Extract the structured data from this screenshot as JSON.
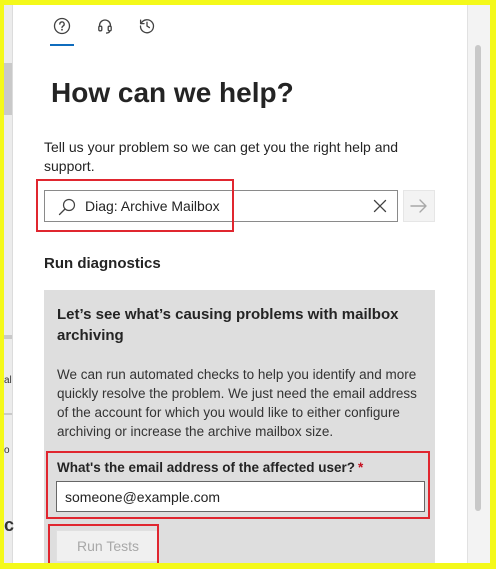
{
  "tabs": [
    {
      "name": "help",
      "icon": "question-circle-icon",
      "active": true
    },
    {
      "name": "support",
      "icon": "headset-icon",
      "active": false
    },
    {
      "name": "history",
      "icon": "history-icon",
      "active": false
    }
  ],
  "title": "How can we help?",
  "intro": "Tell us your problem so we can get you the right help and support.",
  "search": {
    "value": "Diag: Archive Mailbox",
    "icon": "search-icon",
    "clear_icon": "close-icon",
    "submit_icon": "arrow-right-icon"
  },
  "section_title": "Run diagnostics",
  "diagnostic": {
    "title": "Let’s see what’s causing problems with mailbox archiving",
    "description": "We can run automated checks to help you identify and more quickly resolve the problem. We just need the email address of the account for which you would like to either configure archiving or increase the archive mailbox size.",
    "email_label": "What's the email address of the affected user?",
    "required_marker": "*",
    "email_value": "someone@example.com",
    "run_button": "Run Tests"
  },
  "left_edge": {
    "glyph_1": "al",
    "glyph_2": "o",
    "glyph_3": "c"
  },
  "colors": {
    "accent": "#0f6cbd",
    "highlight": "#e0262f",
    "card_bg": "#dedede",
    "required": "#c50f1f"
  }
}
